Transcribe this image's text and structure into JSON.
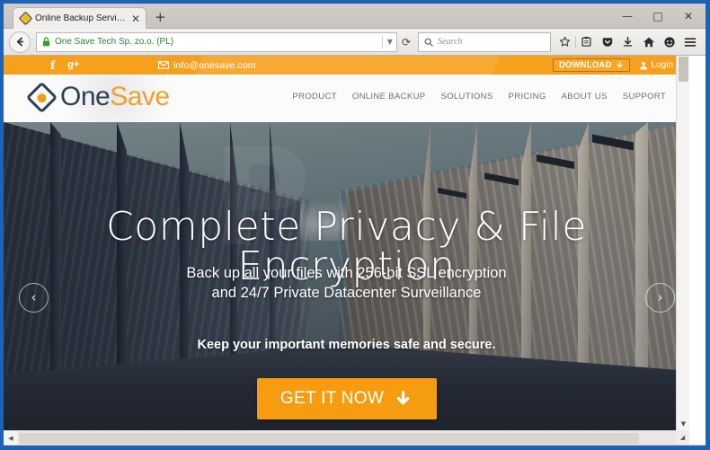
{
  "browser": {
    "tab": {
      "title": "Online Backup Services, Cl...",
      "favicon": "diamond-favicon",
      "close_label": "✕"
    },
    "new_tab_label": "+",
    "window_controls": {
      "minimize": "—",
      "maximize": "□",
      "close": "✕"
    },
    "back_button": "back-arrow",
    "identity": "One Save Tech Sp. zo.o. (PL)",
    "url_dropdown": "▼",
    "reload": "⟳",
    "search": {
      "placeholder": "Search",
      "icon": "search-icon"
    },
    "toolbar_icons": [
      "bookmark-star-icon",
      "library-icon",
      "pocket-icon",
      "downloads-icon",
      "home-icon",
      "account-icon",
      "hamburger-menu-icon"
    ]
  },
  "site": {
    "topbar": {
      "social": [
        {
          "name": "facebook-icon",
          "glyph": "f"
        },
        {
          "name": "google-plus-icon",
          "glyph": "g+"
        }
      ],
      "email": "info@onesave.com",
      "email_icon": "envelope-icon",
      "download_label": "DOWNLOAD",
      "download_arrow": "⬇",
      "login_label": "Login",
      "login_icon": "user-icon"
    },
    "logo": {
      "part_one": "One",
      "part_two": "Save",
      "mark": "diamond-logo-icon"
    },
    "nav": [
      {
        "label": "PRODUCT"
      },
      {
        "label": "ONLINE BACKUP"
      },
      {
        "label": "SOLUTIONS"
      },
      {
        "label": "PRICING"
      },
      {
        "label": "ABOUT US"
      },
      {
        "label": "SUPPORT"
      }
    ],
    "hero": {
      "watermark": "P",
      "heading": "Complete Privacy & File Encryption",
      "subheading_line1": "Back up all your files with 256-bit SSL encryption",
      "subheading_line2": "and 24/7 Private Datacenter Surveillance",
      "tagline": "Keep your important memories safe and secure.",
      "cta_label": "GET IT NOW",
      "cta_icon": "download-arrow-icon",
      "prev_arrow": "‹",
      "next_arrow": "›"
    }
  },
  "colors": {
    "accent_orange": "#f5a11e",
    "cta_orange": "#f59c10",
    "logo_navy": "#2e4057",
    "logo_orange": "#f0a030",
    "window_blue": "#1c62b9",
    "identity_green": "#2e7d32"
  },
  "scrollbars": {
    "vertical_down": "▼",
    "horizontal_left": "◀",
    "corner": "◢"
  }
}
